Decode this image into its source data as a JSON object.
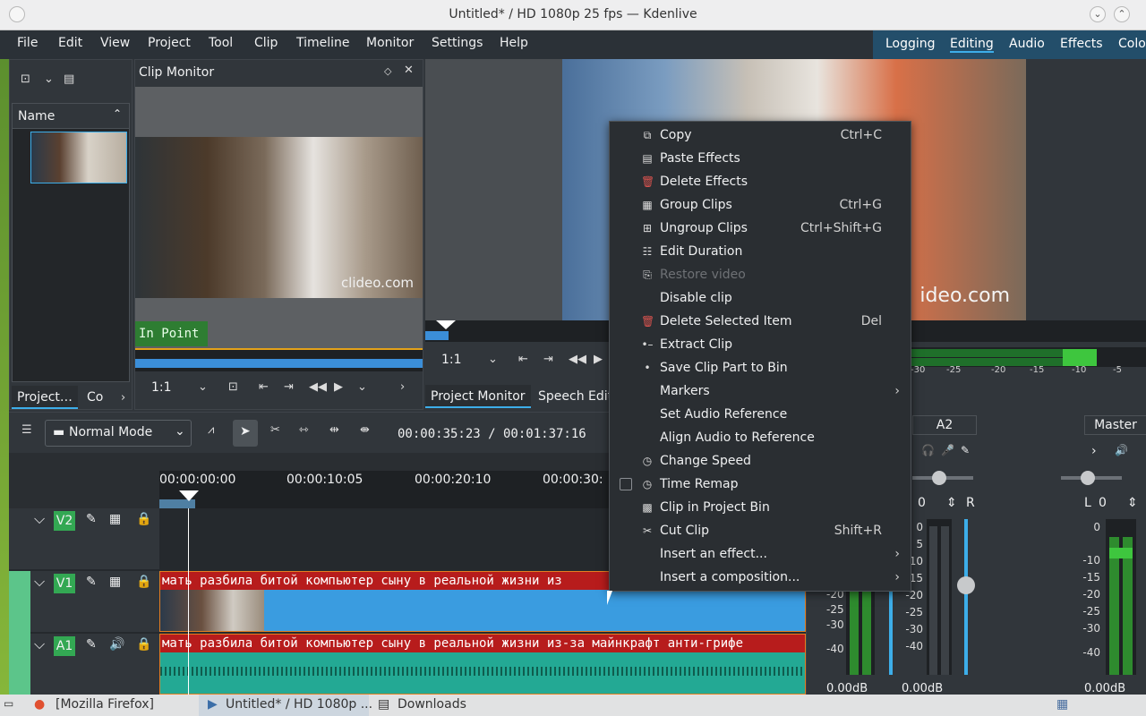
{
  "window": {
    "title": "Untitled* / HD 1080p 25 fps — Kdenlive"
  },
  "menu": [
    "File",
    "Edit",
    "View",
    "Project",
    "Tool",
    "Clip",
    "Timeline",
    "Monitor",
    "Settings",
    "Help"
  ],
  "layouts": [
    "Logging",
    "Editing",
    "Audio",
    "Effects",
    "Colo"
  ],
  "bin": {
    "header": "Name"
  },
  "clip_monitor": {
    "title": "Clip Monitor",
    "watermark": "clideo.com",
    "in_point": "In Point",
    "zoom": "1:1"
  },
  "project_monitor": {
    "watermark": "ideo.com",
    "zoom": "1:1"
  },
  "tabs": {
    "project": "Project…",
    "col": "Co",
    "project_monitor": "Project Monitor",
    "speech": "Speech Edit"
  },
  "toolbar": {
    "mode": "Normal Mode",
    "timecode": "00:00:35:23 / 00:01:37:16"
  },
  "timeline": {
    "ticks": [
      "00:00:00:00",
      "00:00:10:05",
      "00:00:20:10",
      "00:00:30:"
    ],
    "tracks": [
      {
        "name": "V2"
      },
      {
        "name": "V1"
      },
      {
        "name": "A1"
      }
    ],
    "clip_title": "мать разбила битой компьютер сыну в реальной жизни из-за майнкрафт анти-грифе",
    "clip_title_short": "мать разбила битой компьютер сыну в реальной жизни из"
  },
  "context_menu": [
    {
      "label": "Copy",
      "shortcut": "Ctrl+C",
      "icon": "copy-icon",
      "glyph": "⧉"
    },
    {
      "label": "Paste Effects",
      "shortcut": "",
      "icon": "paste-icon",
      "glyph": "▤"
    },
    {
      "label": "Delete Effects",
      "shortcut": "",
      "icon": "trash-icon",
      "glyph": "🗑"
    },
    {
      "label": "Group Clips",
      "shortcut": "Ctrl+G",
      "icon": "group-icon",
      "glyph": "▦"
    },
    {
      "label": "Ungroup Clips",
      "shortcut": "Ctrl+Shift+G",
      "icon": "ungroup-icon",
      "glyph": "⊞"
    },
    {
      "label": "Edit Duration",
      "shortcut": "",
      "icon": "duration-icon",
      "glyph": "☷"
    },
    {
      "label": "Restore video",
      "shortcut": "",
      "icon": "restore-icon",
      "glyph": "⎘",
      "disabled": true
    },
    {
      "label": "Disable clip",
      "shortcut": "",
      "icon": "",
      "glyph": ""
    },
    {
      "label": "Delete Selected Item",
      "shortcut": "Del",
      "icon": "trash-icon",
      "glyph": "🗑"
    },
    {
      "label": "Extract Clip",
      "shortcut": "",
      "icon": "extract-icon",
      "glyph": "•–•"
    },
    {
      "label": "Save Clip Part to Bin",
      "shortcut": "",
      "icon": "",
      "glyph": ""
    },
    {
      "label": "Markers",
      "shortcut": "",
      "icon": "",
      "glyph": "",
      "submenu": true
    },
    {
      "label": "Set Audio Reference",
      "shortcut": "",
      "icon": "",
      "glyph": ""
    },
    {
      "label": "Align Audio to Reference",
      "shortcut": "",
      "icon": "",
      "glyph": ""
    },
    {
      "label": "Change Speed",
      "shortcut": "",
      "icon": "speed-icon",
      "glyph": "◷"
    },
    {
      "label": "Time Remap",
      "shortcut": "",
      "icon": "speed-icon",
      "glyph": "◷",
      "checkbox": true
    },
    {
      "label": "Clip in Project Bin",
      "shortcut": "",
      "icon": "bin-icon",
      "glyph": "▩"
    },
    {
      "label": "Cut Clip",
      "shortcut": "Shift+R",
      "icon": "scissors-icon",
      "glyph": "✂"
    },
    {
      "label": "Insert an effect...",
      "shortcut": "",
      "icon": "",
      "glyph": "",
      "submenu": true
    },
    {
      "label": "Insert a composition...",
      "shortcut": "",
      "icon": "",
      "glyph": "",
      "submenu": true
    }
  ],
  "mixer": {
    "a2": "A2",
    "master": "Master",
    "val_a2": "0",
    "val_master": "0",
    "r": "R",
    "l": "L",
    "db1": "0.00dB",
    "db2": "0.00dB",
    "db3": "0.00dB",
    "scale_left": [
      "-20",
      "-25",
      "-30",
      "-40"
    ],
    "scale_mid": [
      "0",
      "5",
      "10",
      "15",
      "-20",
      "-25",
      "-30",
      "-40"
    ],
    "scale_master": [
      "0",
      "-10",
      "-15",
      "-20",
      "-25",
      "-30",
      "-40"
    ],
    "meter_scale": [
      "-30",
      "-25",
      "-20",
      "-15",
      "-10",
      "-5"
    ]
  },
  "taskbar": [
    "[Mozilla Firefox]",
    "Untitled* / HD 1080p ...",
    "Downloads"
  ]
}
